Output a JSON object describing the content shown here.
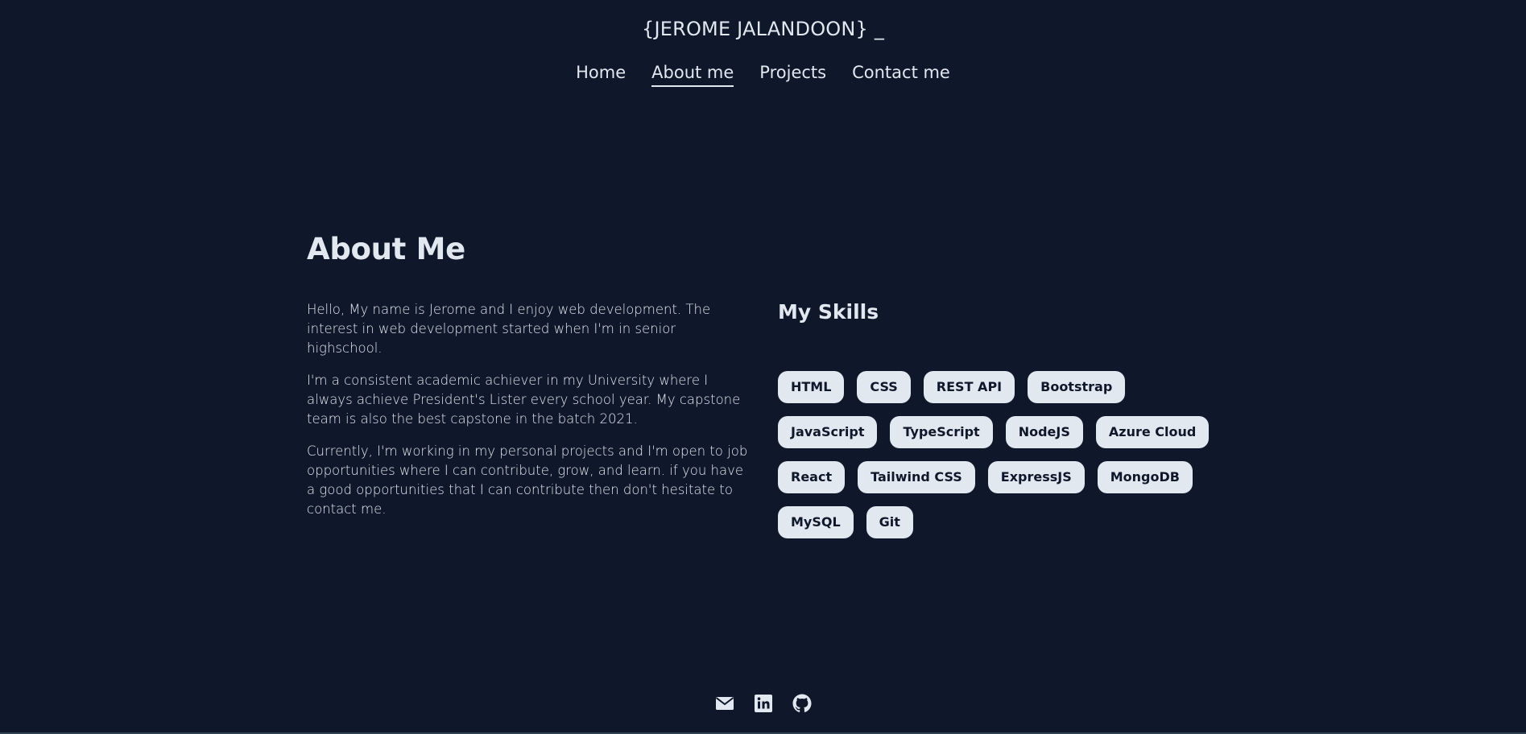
{
  "header": {
    "title": "{JEROME JALANDOON} _",
    "nav": [
      {
        "label": "Home",
        "active": false
      },
      {
        "label": "About me",
        "active": true
      },
      {
        "label": "Projects",
        "active": false
      },
      {
        "label": "Contact me",
        "active": false
      }
    ]
  },
  "about": {
    "heading": "About Me",
    "paragraphs": [
      "Hello, My name is Jerome and I enjoy web development. The interest in web development started when I'm in senior highschool.",
      "I'm a consistent academic achiever in my University where I always achieve President's Lister every school year. My capstone team is also the best capstone in the batch 2021.",
      "Currently, I'm working in my personal projects and I'm open to job opportunities where I can contribute, grow, and learn. if you have a good opportunities that I can contribute then don't hesitate to contact me."
    ]
  },
  "skills": {
    "heading": "My Skills",
    "items": [
      "HTML",
      "CSS",
      "REST API",
      "Bootstrap",
      "JavaScript",
      "TypeScript",
      "NodeJS",
      "Azure Cloud",
      "React",
      "Tailwind CSS",
      "ExpressJS",
      "MongoDB",
      "MySQL",
      "Git"
    ]
  },
  "footer": {
    "icons": [
      "email-icon",
      "linkedin-icon",
      "github-icon"
    ]
  },
  "colors": {
    "background": "#0f172a",
    "text": "#e2e8f0",
    "chip_background": "#e2e8f0",
    "chip_text": "#0f172a"
  }
}
